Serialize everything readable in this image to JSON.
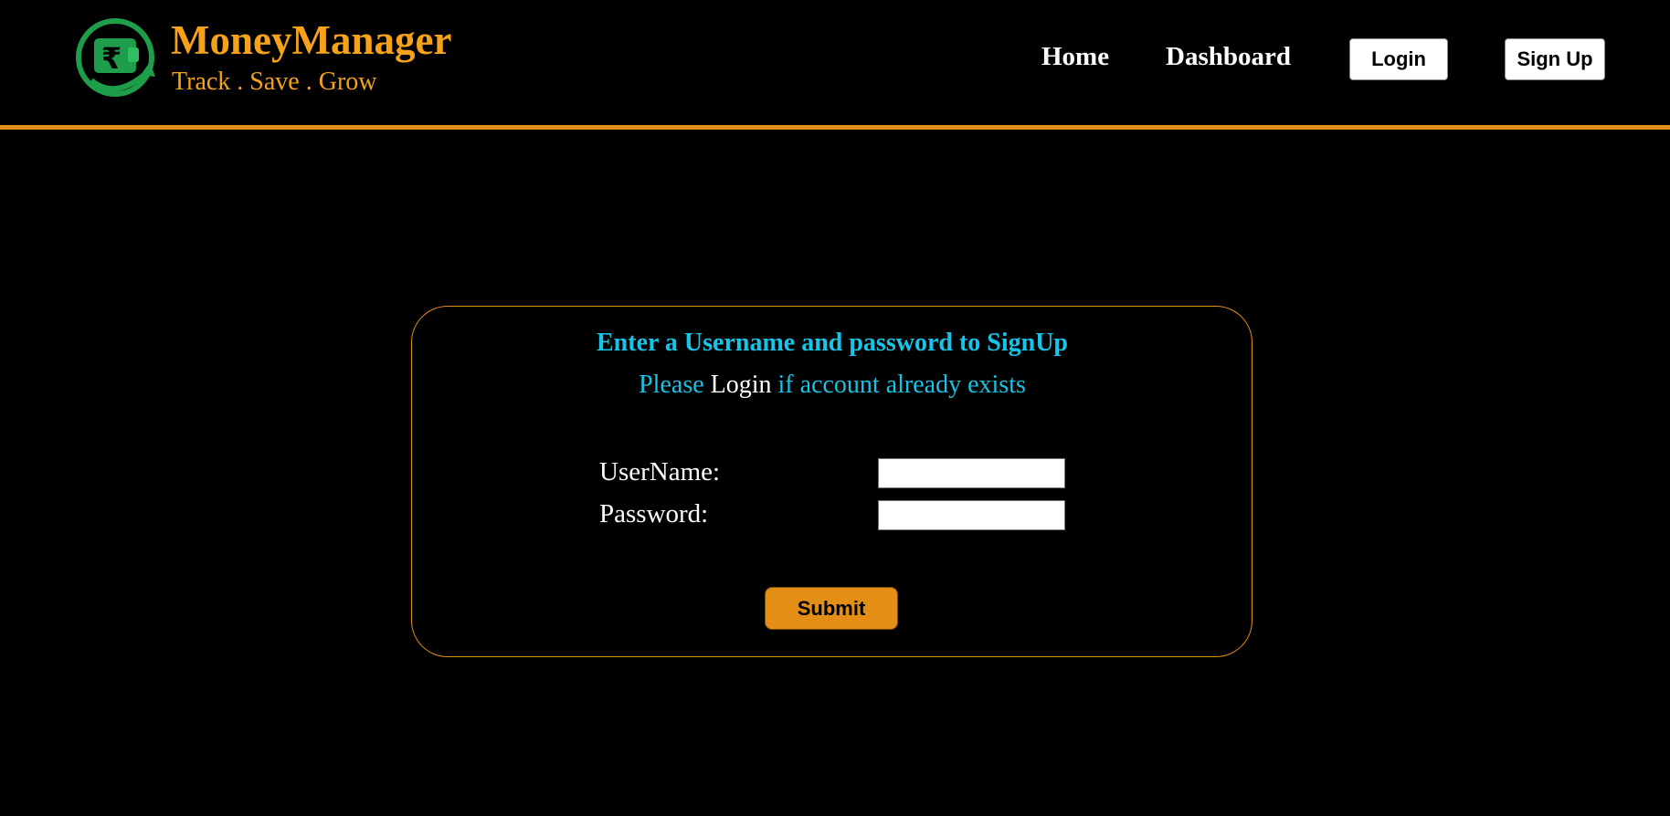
{
  "header": {
    "brand_name": "MoneyManager",
    "tagline": "Track . Save . Grow",
    "logo_icon": "rupee-wallet-icon",
    "nav": {
      "home": "Home",
      "dashboard": "Dashboard",
      "login": "Login",
      "signup": "Sign Up"
    }
  },
  "signup_form": {
    "title": "Enter a Username and password to SignUp",
    "subtitle_before": "Please ",
    "subtitle_link": "Login",
    "subtitle_after": " if account already exists",
    "username_label": "UserName:",
    "password_label": "Password:",
    "username_value": "",
    "password_value": "",
    "submit_label": "Submit"
  },
  "colors": {
    "background": "#000000",
    "accent": "#e38e14",
    "brand": "#f5a21a",
    "heading": "#17c3e6",
    "logo_green": "#1e9e4a"
  }
}
